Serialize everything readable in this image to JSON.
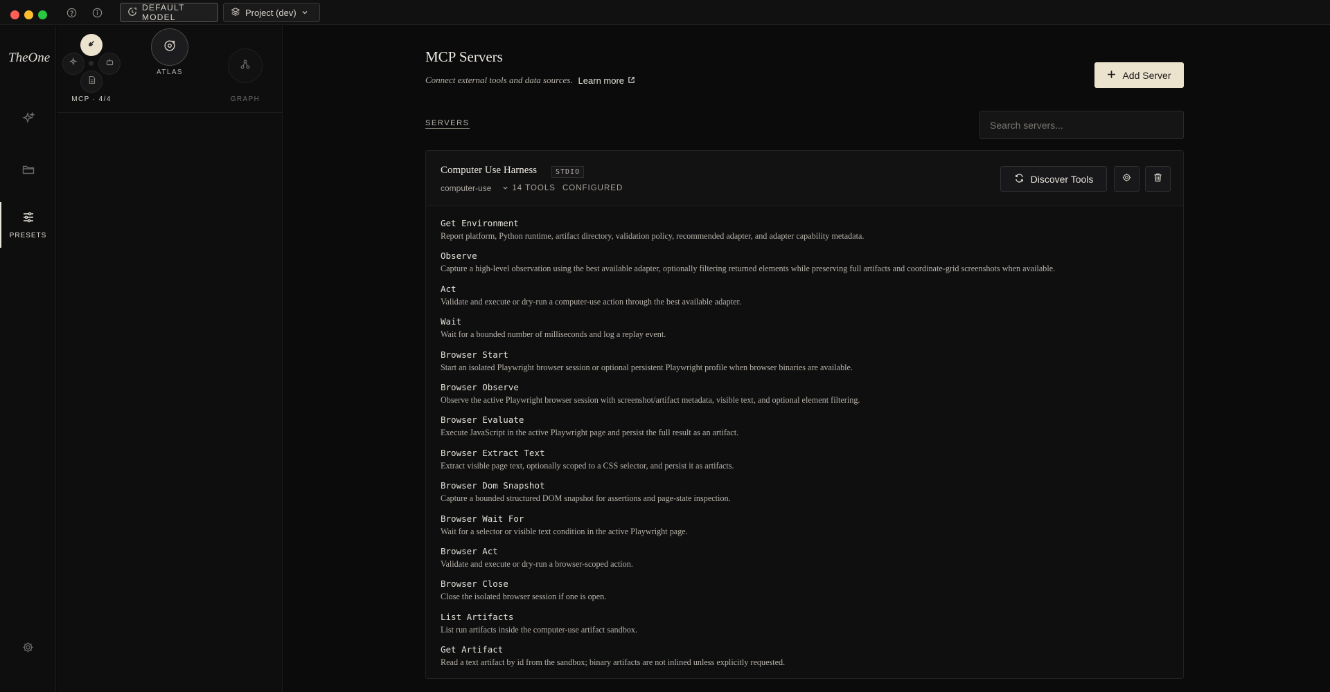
{
  "titlebar": {
    "model_label": "DEFAULT MODEL",
    "project_label": "Project (dev)"
  },
  "rail": {
    "logo": "TheOne",
    "presets_label": "PRESETS"
  },
  "panel": {
    "mcp_caption": "MCP · 4/4",
    "atlas_caption": "ATLAS",
    "graph_caption": "GRAPH"
  },
  "main": {
    "title": "MCP Servers",
    "subtitle": "Connect external tools and data sources.",
    "learn_more": "Learn more",
    "add_server": "Add Server",
    "servers_label": "SERVERS",
    "search_placeholder": "Search servers..."
  },
  "server": {
    "name": "Computer Use Harness",
    "transport": "STDIO",
    "id": "computer-use",
    "tools_count": "14 TOOLS",
    "status": "CONFIGURED",
    "discover_label": "Discover Tools",
    "tools": [
      {
        "name": "Get Environment",
        "desc": "Report platform, Python runtime, artifact directory, validation policy, recommended adapter, and adapter capability metadata."
      },
      {
        "name": "Observe",
        "desc": "Capture a high-level observation using the best available adapter, optionally filtering returned elements while preserving full artifacts and coordinate-grid screenshots when available."
      },
      {
        "name": "Act",
        "desc": "Validate and execute or dry-run a computer-use action through the best available adapter."
      },
      {
        "name": "Wait",
        "desc": "Wait for a bounded number of milliseconds and log a replay event."
      },
      {
        "name": "Browser Start",
        "desc": "Start an isolated Playwright browser session or optional persistent Playwright profile when browser binaries are available."
      },
      {
        "name": "Browser Observe",
        "desc": "Observe the active Playwright browser session with screenshot/artifact metadata, visible text, and optional element filtering."
      },
      {
        "name": "Browser Evaluate",
        "desc": "Execute JavaScript in the active Playwright page and persist the full result as an artifact."
      },
      {
        "name": "Browser Extract Text",
        "desc": "Extract visible page text, optionally scoped to a CSS selector, and persist it as artifacts."
      },
      {
        "name": "Browser Dom Snapshot",
        "desc": "Capture a bounded structured DOM snapshot for assertions and page-state inspection."
      },
      {
        "name": "Browser Wait For",
        "desc": "Wait for a selector or visible text condition in the active Playwright page."
      },
      {
        "name": "Browser Act",
        "desc": "Validate and execute or dry-run a browser-scoped action."
      },
      {
        "name": "Browser Close",
        "desc": "Close the isolated browser session if one is open."
      },
      {
        "name": "List Artifacts",
        "desc": "List run artifacts inside the computer-use artifact sandbox."
      },
      {
        "name": "Get Artifact",
        "desc": "Read a text artifact by id from the sandbox; binary artifacts are not inlined unless explicitly requested."
      }
    ]
  },
  "colors": {
    "accent": "#ece3cf",
    "background": "#0b0b0c"
  }
}
